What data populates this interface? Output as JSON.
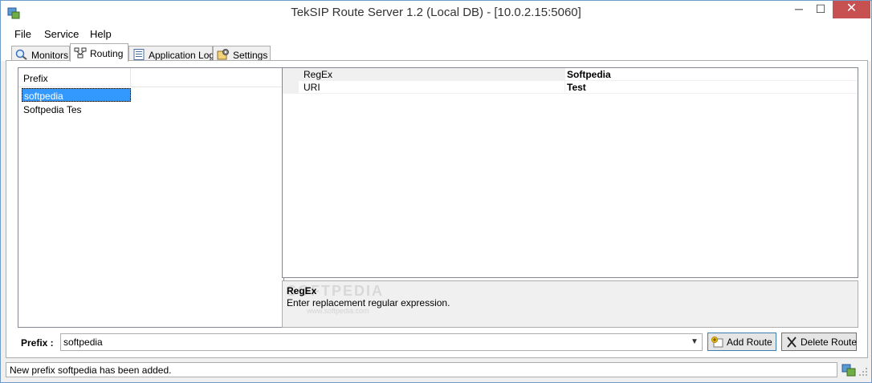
{
  "window": {
    "title": "TekSIP Route Server 1.2 (Local DB) - [10.0.2.15:5060]",
    "minimize_label": "─",
    "maximize_label": "☐",
    "close_label": "✕"
  },
  "menu": {
    "items": [
      {
        "label": "File"
      },
      {
        "label": "Service"
      },
      {
        "label": "Help"
      }
    ]
  },
  "tabs": [
    {
      "label": "Monitors",
      "icon": "magnifier-icon"
    },
    {
      "label": "Routing",
      "icon": "routing-icon",
      "active": true
    },
    {
      "label": "Application Log",
      "icon": "log-icon"
    },
    {
      "label": "Settings",
      "icon": "settings-icon"
    }
  ],
  "prefix_list": {
    "header": "Prefix",
    "items": [
      {
        "label": "softpedia",
        "selected": true
      },
      {
        "label": "Softpedia Tes"
      }
    ]
  },
  "property_grid": {
    "rows": [
      {
        "name": "RegEx",
        "value": "Softpedia",
        "selected": true
      },
      {
        "name": "URI",
        "value": "Test"
      }
    ]
  },
  "description": {
    "title": "RegEx",
    "text": "Enter replacement regular expression.",
    "watermark": "SOFTPEDIA",
    "watermark_url": "www.softpedia.com"
  },
  "bottom": {
    "prefix_label": "Prefix :",
    "prefix_value": "softpedia",
    "add_route_label": "Add Route",
    "delete_route_label": "Delete Route"
  },
  "status": {
    "message": "New prefix softpedia has been added."
  },
  "colors": {
    "selection": "#3399ff",
    "close_button": "#c75050",
    "window_border": "#6f9bc9"
  }
}
